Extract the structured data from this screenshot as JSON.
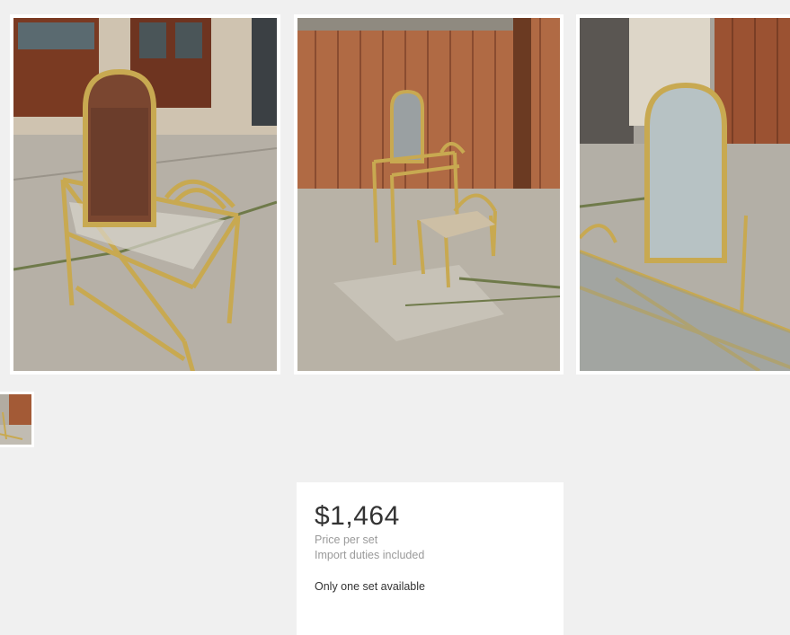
{
  "gallery": {
    "images": [
      {
        "name": "vanity-mirror-front-view"
      },
      {
        "name": "vanity-with-chair-view"
      },
      {
        "name": "vanity-mirror-close-view"
      }
    ],
    "thumbnails": [
      {
        "name": "vanity-thumbnail"
      }
    ]
  },
  "pricing": {
    "price": "$1,464",
    "price_per_label": "Price per set",
    "duties_label": "Import duties included",
    "availability": "Only one set available"
  },
  "colors": {
    "page_background": "#f0f0f0",
    "card_background": "#ffffff",
    "price_text": "#333333",
    "muted_text": "#9a9a9a",
    "brass": "#c8a951",
    "wood": "#a0522d"
  }
}
